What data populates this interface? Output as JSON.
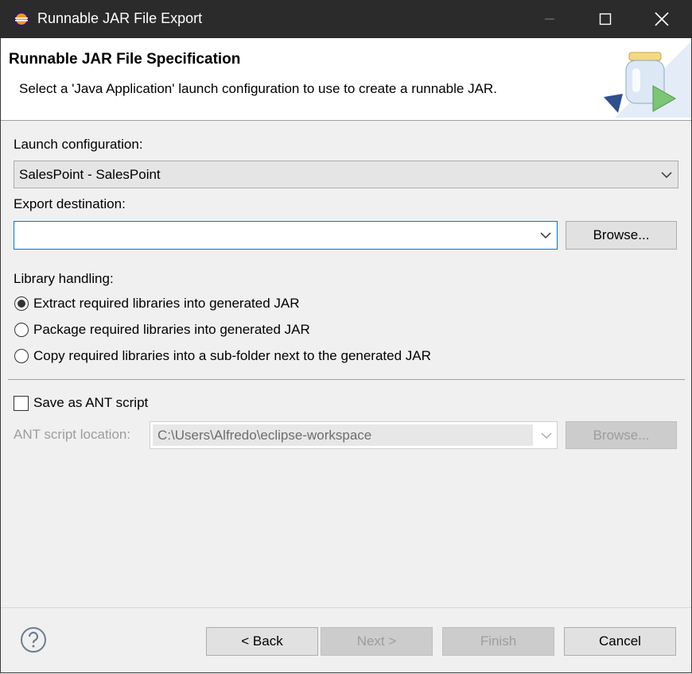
{
  "window": {
    "title": "Runnable JAR File Export",
    "icon": "eclipse-icon",
    "controls": [
      "minimize-icon",
      "maximize-icon",
      "close-icon"
    ]
  },
  "banner": {
    "heading": "Runnable JAR File Specification",
    "description": "Select a 'Java Application' launch configuration to use to create a runnable JAR.",
    "image": "jar-export-wizard-icon"
  },
  "launch": {
    "label": "Launch configuration:",
    "value": "SalesPoint - SalesPoint"
  },
  "destination": {
    "label": "Export destination:",
    "value": "",
    "browse_label": "Browse..."
  },
  "library": {
    "label": "Library handling:",
    "options": [
      {
        "label": "Extract required libraries into generated JAR",
        "selected": true
      },
      {
        "label": "Package required libraries into generated JAR",
        "selected": false
      },
      {
        "label": "Copy required libraries into a sub-folder next to the generated JAR",
        "selected": false
      }
    ]
  },
  "ant": {
    "checkbox_label": "Save as ANT script",
    "checked": false,
    "location_label": "ANT script location:",
    "location_value": "C:\\Users\\Alfredo\\eclipse-workspace",
    "browse_label": "Browse..."
  },
  "footer": {
    "help_icon": "help-icon",
    "back_label": "< Back",
    "next_label": "Next >",
    "finish_label": "Finish",
    "cancel_label": "Cancel"
  },
  "colors": {
    "titlebar": "#2b2b2b",
    "focus_border": "#0078d7",
    "disabled_text": "#9d9d9d"
  }
}
